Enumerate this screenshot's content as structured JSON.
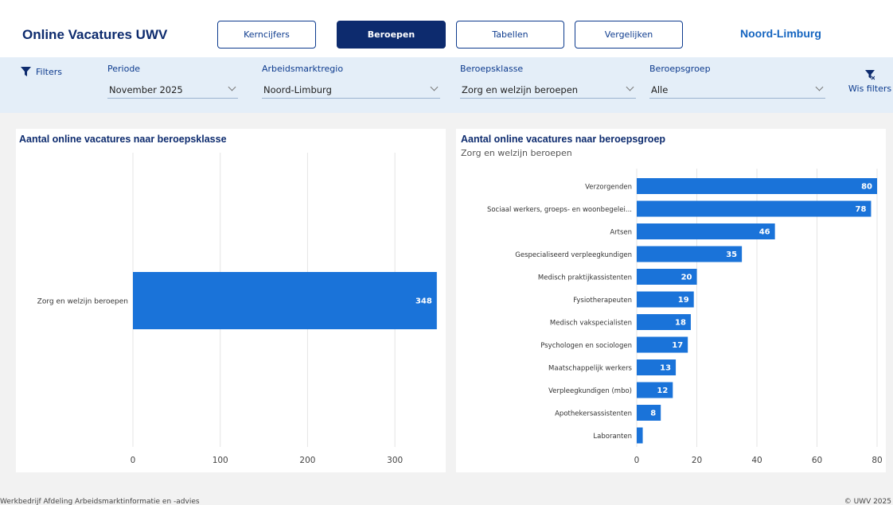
{
  "header": {
    "title": "Online Vacatures UWV",
    "nav": [
      {
        "label": "Kerncijfers",
        "active": false
      },
      {
        "label": "Beroepen",
        "active": true
      },
      {
        "label": "Tabellen",
        "active": false
      },
      {
        "label": "Vergelijken",
        "active": false
      }
    ],
    "region": "Noord-Limburg"
  },
  "filters": {
    "toggle_label": "Filters",
    "periode": {
      "label": "Periode",
      "value": "November 2025"
    },
    "regio": {
      "label": "Arbeidsmarktregio",
      "value": "Noord-Limburg"
    },
    "klasse": {
      "label": "Beroepsklasse",
      "value": "Zorg en welzijn beroepen"
    },
    "groep": {
      "label": "Beroepsgroep",
      "value": "Alle"
    },
    "clear_label": "Wis filters"
  },
  "left_panel": {
    "title": "Aantal online vacatures naar beroepsklasse"
  },
  "right_panel": {
    "title": "Aantal online vacatures naar beroepsgroep",
    "subtitle": "Zorg en welzijn beroepen"
  },
  "chart_data": [
    {
      "type": "bar",
      "orientation": "horizontal",
      "categories": [
        "Zorg en welzijn beroepen"
      ],
      "values": [
        348
      ],
      "xlim": [
        0,
        360
      ],
      "xticks": [
        0,
        100,
        200,
        300
      ],
      "color": "#1a73d9",
      "grid": true
    },
    {
      "type": "bar",
      "orientation": "horizontal",
      "categories": [
        "Verzorgenden",
        "Sociaal werkers, groeps- en woonbegelei...",
        "Artsen",
        "Gespecialiseerd verpleegkundigen",
        "Medisch praktijkassistenten",
        "Fysiotherapeuten",
        "Medisch vakspecialisten",
        "Psychologen en sociologen",
        "Maatschappelijk werkers",
        "Verpleegkundigen (mbo)",
        "Apothekersassistenten",
        "Laboranten"
      ],
      "values": [
        80,
        78,
        46,
        35,
        20,
        19,
        18,
        17,
        13,
        12,
        8,
        2
      ],
      "value_labels": [
        "80",
        "78",
        "46",
        "35",
        "20",
        "19",
        "18",
        "17",
        "13",
        "12",
        "8",
        ""
      ],
      "xlim": [
        0,
        80
      ],
      "xticks": [
        0,
        20,
        40,
        60,
        80
      ],
      "color": "#1a73d9",
      "grid": true
    }
  ],
  "footer": {
    "left": "Werkbedrijf Afdeling Arbeidsmarktinformatie en -advies",
    "right": "© UWV 2025"
  }
}
